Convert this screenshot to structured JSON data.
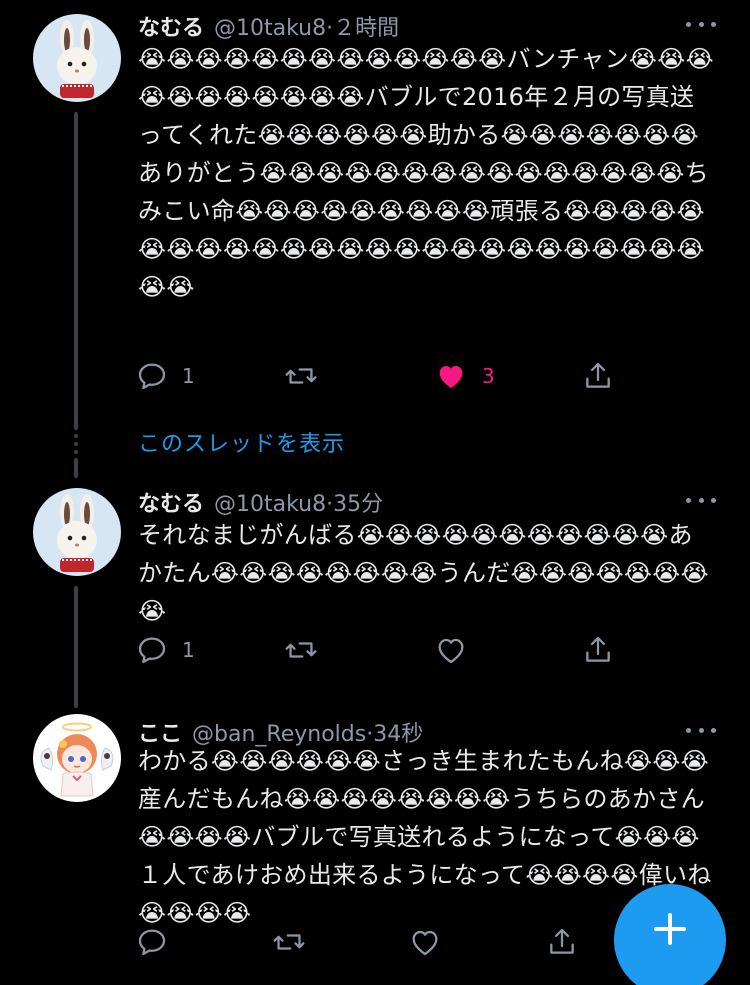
{
  "tweets": [
    {
      "name": "なむる",
      "handle": "@10taku8",
      "time": "·２時間",
      "text": "😭😭😭😭😭😭😭😭😭😭😭😭😭バンチャン😭😭😭😭😭😭😭😭😭😭😭バブルで2016年２月の写真送ってくれた😭😭😭😭😭😭助かる😭😭😭😭😭😭😭ありがとう😭😭😭😭😭😭😭😭😭😭😭😭😭😭😭ちみこい命😭😭😭😭😭😭😭😭😭頑張る😭😭😭😭😭😭😭😭😭😭😭😭😭😭😭😭😭😭😭😭😭😭😭😭😭😭😭",
      "reply_count": "1",
      "retweet_count": "",
      "like_count": "3",
      "liked": true,
      "avatar_icon": "rabbit-icon"
    },
    {
      "name": "なむる",
      "handle": "@10taku8",
      "time": "·35分",
      "text": "それなまじがんばる😭😭😭😭😭😭😭😭😭😭😭あかたん😭😭😭😭😭😭😭😭うんだ😭😭😭😭😭😭😭😭",
      "reply_count": "1",
      "retweet_count": "",
      "like_count": "",
      "liked": false,
      "avatar_icon": "rabbit-icon"
    },
    {
      "name": "ここ",
      "handle": "@ban_Reynolds",
      "time": "·34秒",
      "text": "わかる😭😭😭😭😭😭さっき生まれたもんね😭😭😭産んだもんね😭😭😭😭😭😭😭😭うちらのあかさん😭😭😭😭バブルで写真送れるようになって😭😭😭１人であけおめ出来るようになって😭😭😭😭偉いね😭😭😭😭",
      "reply_count": "",
      "retweet_count": "",
      "like_count": "",
      "liked": false,
      "avatar_icon": "angel-girl-icon"
    }
  ],
  "show_thread_label": "このスレッドを表示",
  "fab_icon": "plus-icon",
  "colors": {
    "background": "#000000",
    "accent": "#1d9bf0",
    "like": "#f91880",
    "secondary_text": "#8b98a5"
  }
}
